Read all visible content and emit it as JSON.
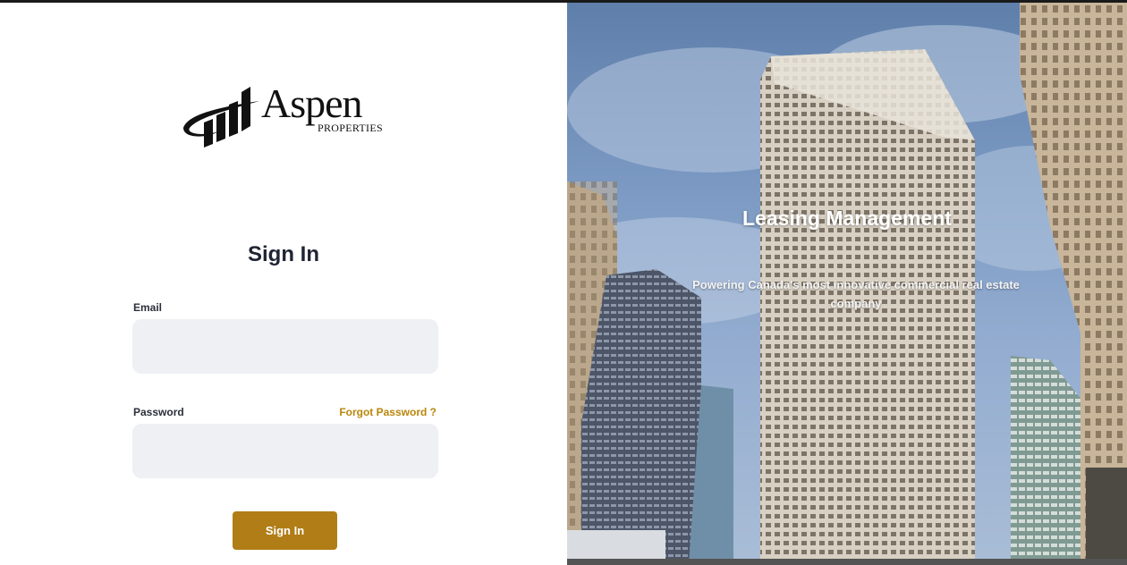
{
  "brand": {
    "name": "Aspen",
    "tagline": "PROPERTIES",
    "accent_color": "#b07d16"
  },
  "form": {
    "title": "Sign In",
    "email_label": "Email",
    "email_value": "",
    "password_label": "Password",
    "password_value": "",
    "forgot_label": "Forgot Password ?",
    "submit_label": "Sign In"
  },
  "hero": {
    "title": "Leasing Management",
    "subtitle": "Powering Canada's most innovative commercial real estate company"
  }
}
